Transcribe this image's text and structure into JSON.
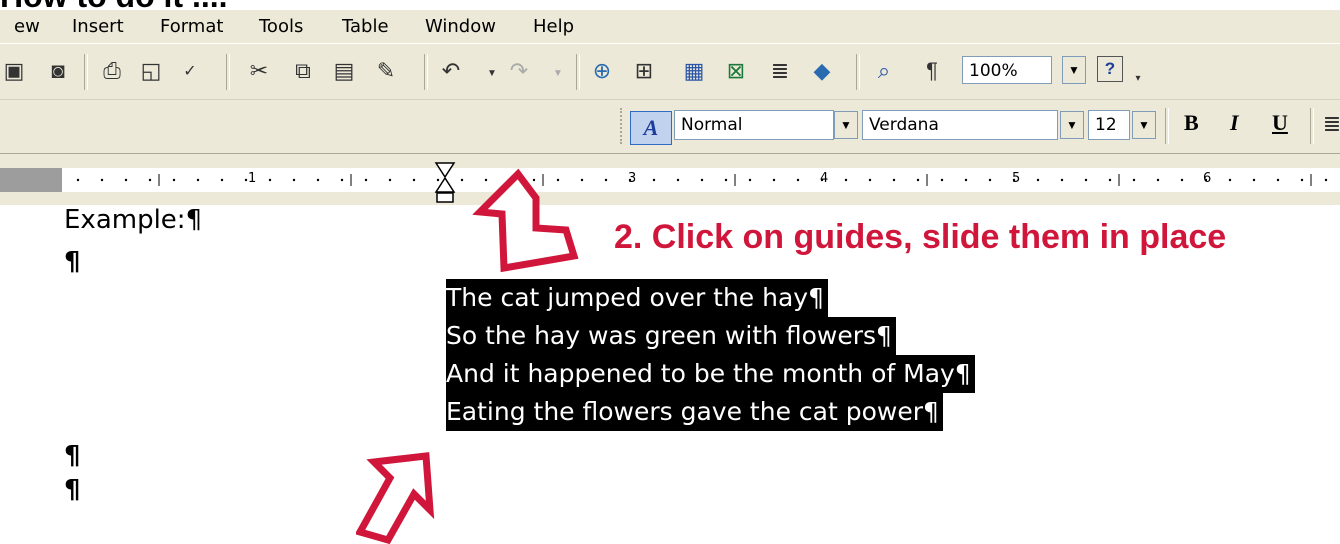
{
  "page_heading": "How to do it ....",
  "menu": [
    "ew",
    "Insert",
    "Format",
    "Tools",
    "Table",
    "Window",
    "Help"
  ],
  "toolbar": {
    "zoom": "100%",
    "paragraph_mark": "¶",
    "help_icon": "?",
    "dropdown_glyph": "▼"
  },
  "formatting": {
    "style": "Normal",
    "font": "Verdana",
    "size": "12",
    "bold": "B",
    "italic": "I",
    "underline": "U"
  },
  "ruler": {
    "numbers": [
      "1",
      "3",
      "4",
      "5",
      "6"
    ]
  },
  "document": {
    "heading": "Example:",
    "pilcrow": "¶",
    "selected_lines": [
      "The cat jumped over the hay",
      "So the hay was green with flowers",
      "And it happened to be the month of May",
      "Eating the flowers gave the cat power"
    ]
  },
  "annotation": "2.  Click on guides, slide them in place",
  "colors": {
    "annotation_red": "#d0163a",
    "toolbar_bg": "#ece9d8",
    "selection_bg": "#000000"
  }
}
